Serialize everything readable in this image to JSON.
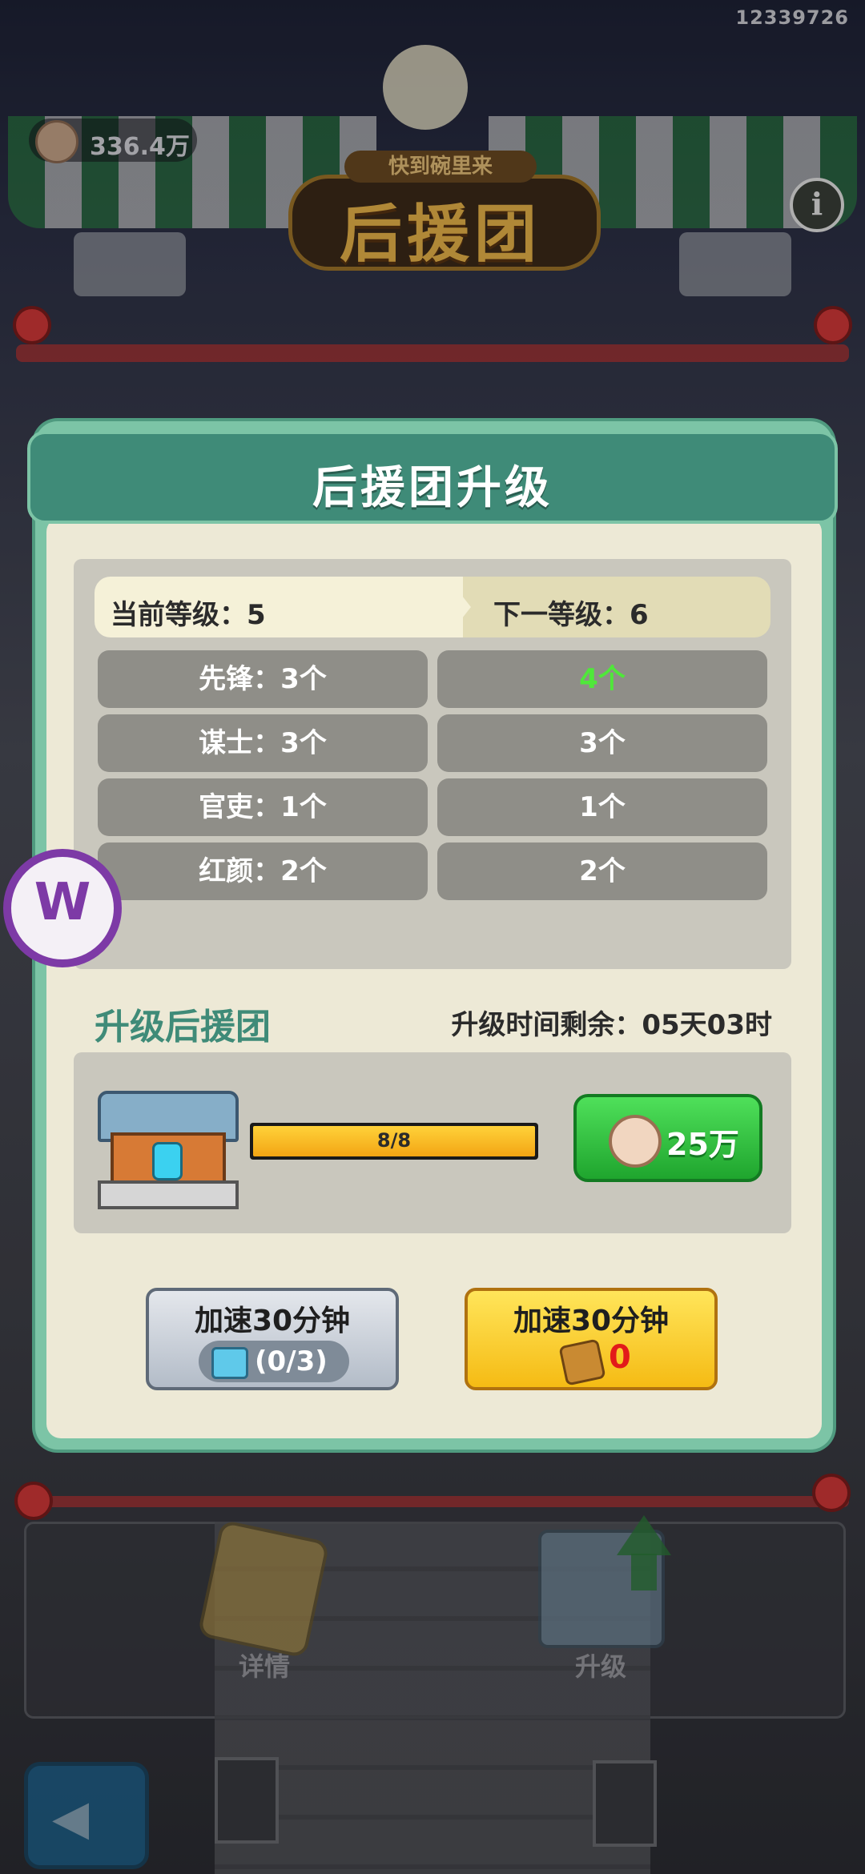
{
  "status": {
    "build_id": "12339726"
  },
  "header": {
    "currency": "336.4万",
    "logo_top": "快到碗里来",
    "logo_main": "后援团",
    "info_label": "i"
  },
  "dialog": {
    "title": "后援团升级",
    "current_level": "当前等级：5",
    "next_level": "下一等级：6",
    "rows": [
      {
        "current": "先锋：3个",
        "next": "4个"
      },
      {
        "current": "谋士：3个",
        "next": "3个"
      },
      {
        "current": "官吏：1个",
        "next": "1个"
      },
      {
        "current": "红颜：2个",
        "next": "2个"
      }
    ],
    "upgrade_section_title": "升级后援团",
    "time_remaining": "升级时间剩余：05天03时",
    "progress": {
      "text": "8/8",
      "fraction": 1.0
    },
    "upgrade_price": "25万",
    "speed_ad": {
      "label": "加速30分钟",
      "count": "(0/3)"
    },
    "speed_item": {
      "label": "加速30分钟",
      "count": "0"
    }
  },
  "bottom_nav": {
    "details_label": "详情",
    "upgrade_label": "升级"
  },
  "overlay_badge": "W",
  "colors": {
    "accent_green": "#3f8b78",
    "buy_green": "#1fa52e",
    "highlight_green": "#4fe83a",
    "speed_yellow": "#f5bb14",
    "panel_bg": "#ede9d6"
  }
}
